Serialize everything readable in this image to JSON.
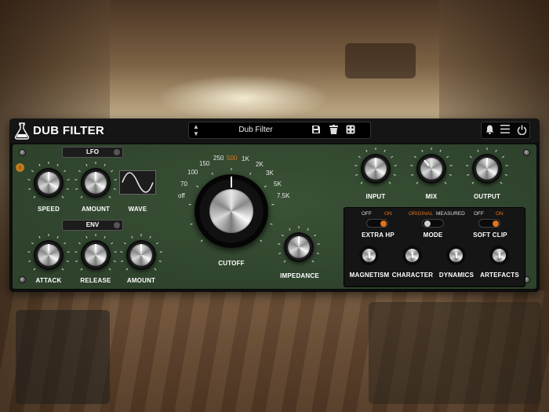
{
  "header": {
    "title": "DUB FILTER",
    "preset_name": "Dub Filter"
  },
  "lfo": {
    "label": "LFO",
    "speed": "SPEED",
    "amount": "AMOUNT",
    "wave": "WAVE"
  },
  "env": {
    "label": "ENV",
    "attack": "ATTACK",
    "release": "RELEASE",
    "amount": "AMOUNT"
  },
  "cutoff": {
    "label": "CUTOFF",
    "scale": [
      "off",
      "70",
      "100",
      "150",
      "250",
      "500",
      "1K",
      "2K",
      "3K",
      "5K",
      "7.5K"
    ],
    "active_value": "500"
  },
  "impedance": {
    "label": "IMPEDANCE"
  },
  "io": {
    "input": "INPUT",
    "mix": "MIX",
    "output": "OUTPUT"
  },
  "switches": {
    "extra_hp": {
      "label": "EXTRA HP",
      "off": "OFF",
      "on": "ON",
      "state": "on"
    },
    "mode": {
      "label": "MODE",
      "opt_a": "ORIGINAL",
      "opt_b": "MEASURED",
      "state": "original"
    },
    "soft_clip": {
      "label": "SOFT CLIP",
      "off": "OFF",
      "on": "ON",
      "state": "on"
    }
  },
  "character": {
    "magnetism": "MAGNETISM",
    "character": "CHARACTER",
    "dynamics": "DYNAMICS",
    "artefacts": "ARTEFACTS"
  },
  "colors": {
    "panel": "#32462f",
    "accent": "#e0731e",
    "header": "#151515"
  }
}
